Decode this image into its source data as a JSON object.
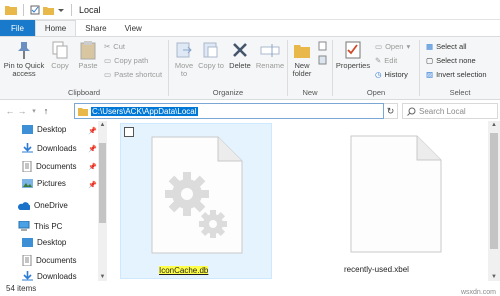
{
  "window": {
    "title": "Local"
  },
  "tabs": [
    "File",
    "Home",
    "Share",
    "View"
  ],
  "ribbon": {
    "clipboard": {
      "label": "Clipboard",
      "pin": "Pin to Quick access",
      "copy": "Copy",
      "paste": "Paste",
      "cut": "Cut",
      "copy_path": "Copy path",
      "paste_shortcut": "Paste shortcut"
    },
    "organize": {
      "label": "Organize",
      "move_to": "Move to",
      "copy_to": "Copy to",
      "delete": "Delete",
      "rename": "Rename"
    },
    "new": {
      "label": "New",
      "new_folder": "New folder"
    },
    "open": {
      "label": "Open",
      "properties": "Properties",
      "open": "Open",
      "edit": "Edit",
      "history": "History"
    },
    "select": {
      "label": "Select",
      "select_all": "Select all",
      "select_none": "Select none",
      "invert": "Invert selection"
    }
  },
  "address": {
    "path": "C:\\Users\\ACK\\AppData\\Local",
    "search_placeholder": "Search Local"
  },
  "nav": {
    "quick": [
      "Desktop",
      "Downloads",
      "Documents",
      "Pictures"
    ],
    "onedrive": "OneDrive",
    "thispc": "This PC",
    "thispc_items": [
      "Desktop",
      "Documents",
      "Downloads"
    ]
  },
  "files": [
    {
      "name": "IconCache.db",
      "selected": true
    },
    {
      "name": "recently-used.xbel",
      "selected": false
    }
  ],
  "status": {
    "count": "54 items"
  },
  "watermark": "wsxdn.com",
  "colors": {
    "accent": "#1979ca",
    "selection_bg": "#e5f3ff",
    "highlight": "#ffff4a"
  }
}
